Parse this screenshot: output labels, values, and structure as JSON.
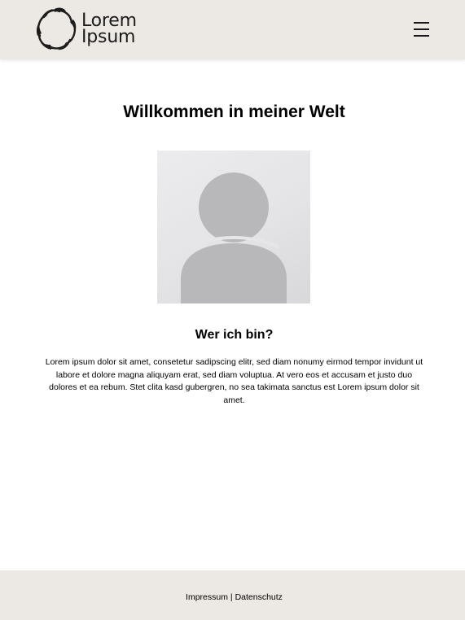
{
  "header": {
    "logo_line1": "Lorem",
    "logo_line2": "Ipsum",
    "menu_icon": "hamburger-menu-icon"
  },
  "main": {
    "title": "Willkommen in meiner Welt",
    "avatar_icon": "user-placeholder-icon",
    "subtitle": "Wer ich bin?",
    "bio": "Lorem ipsum dolor sit amet, consetetur sadipscing elitr, sed diam nonumy eirmod tempor invidunt ut labore et dolore magna aliquyam erat, sed diam voluptua. At vero eos et accusam et justo duo dolores et ea rebum. Stet clita kasd gubergren, no sea takimata sanctus est Lorem ipsum dolor sit amet."
  },
  "footer": {
    "impressum": "Impressum",
    "separator": "|",
    "datenschutz": "Datenschutz"
  },
  "colors": {
    "header_bg": "#ece8e3",
    "footer_bg": "#ece8e3",
    "avatar_bg": "#e4e4e6",
    "avatar_figure": "#b8b8ba"
  }
}
